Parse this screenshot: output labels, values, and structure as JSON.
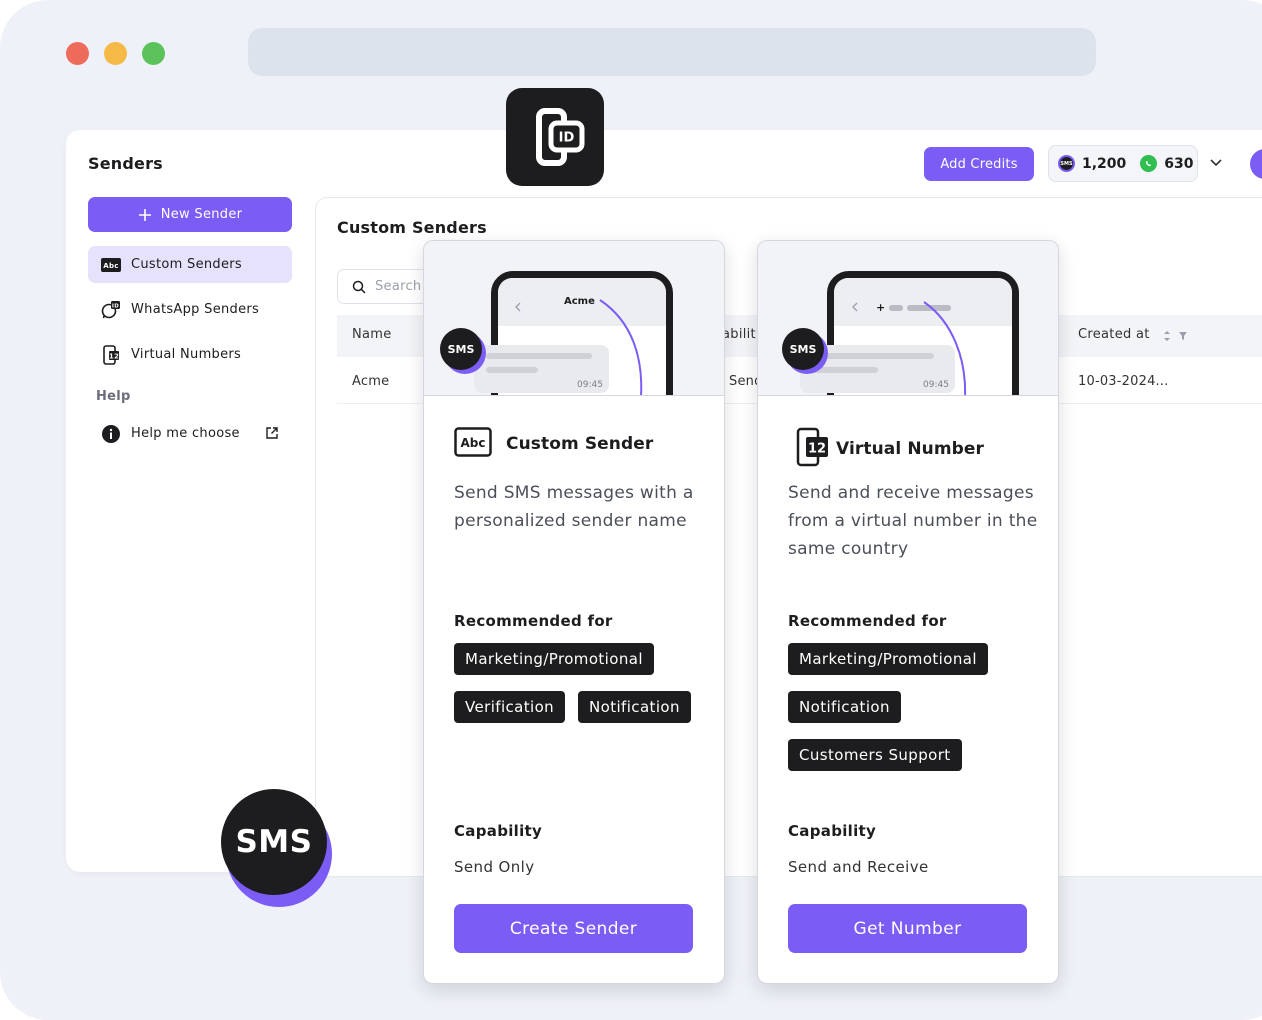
{
  "window": {
    "controls": {
      "close_color": "#ee6b5b",
      "minimize_color": "#f5b945",
      "maximize_color": "#5cc35c"
    }
  },
  "app": {
    "title": "Senders",
    "logo_icon": "sender-id-icon",
    "accent_color": "#7b5cf5"
  },
  "header": {
    "add_credits_label": "Add Credits",
    "sms_balance": "1,200",
    "sms_balance_icon": "sms-icon",
    "whatsapp_balance": "630",
    "whatsapp_balance_icon": "whatsapp-icon",
    "dropdown_icon": "chevron-down-icon"
  },
  "sidebar": {
    "new_sender_label": "New Sender",
    "items": [
      {
        "label": "Custom Senders",
        "icon": "abc-icon",
        "active": true
      },
      {
        "label": "WhatsApp Senders",
        "icon": "whatsapp-id-icon",
        "active": false
      },
      {
        "label": "Virtual Numbers",
        "icon": "virtual-number-icon",
        "active": false
      }
    ],
    "help_heading": "Help",
    "help_item": {
      "label": "Help me choose",
      "icon": "info-icon",
      "trailing_icon": "external-link-icon"
    }
  },
  "main": {
    "title": "Custom Senders",
    "search_placeholder": "Search",
    "columns": [
      "Name",
      "abilit",
      "Created at"
    ],
    "rows": [
      {
        "name": "Acme",
        "capability": "Send",
        "created_at": "10-03-2024..."
      }
    ]
  },
  "cards": [
    {
      "hero": {
        "sender_name": "Acme",
        "time": "09:45",
        "badge": "SMS"
      },
      "icon": "abc-icon",
      "icon_text": "Abc",
      "title": "Custom Sender",
      "description": "Send SMS messages with a personalized sender name",
      "recommended_heading": "Recommended for",
      "tags": [
        "Marketing/Promotional",
        "Verification",
        "Notification"
      ],
      "capability_heading": "Capability",
      "capability": "Send Only",
      "button_label": "Create Sender"
    },
    {
      "hero": {
        "time": "09:45",
        "badge": "SMS"
      },
      "icon": "virtual-number-icon",
      "icon_text": "12",
      "title": "Virtual Number",
      "description": "Send and receive messages from a virtual number in the same country",
      "recommended_heading": "Recommended for",
      "tags": [
        "Marketing/Promotional",
        "Notification",
        "Customers Support"
      ],
      "capability_heading": "Capability",
      "capability": "Send and Receive",
      "button_label": "Get Number"
    }
  ],
  "floating_badge": {
    "label": "SMS"
  }
}
